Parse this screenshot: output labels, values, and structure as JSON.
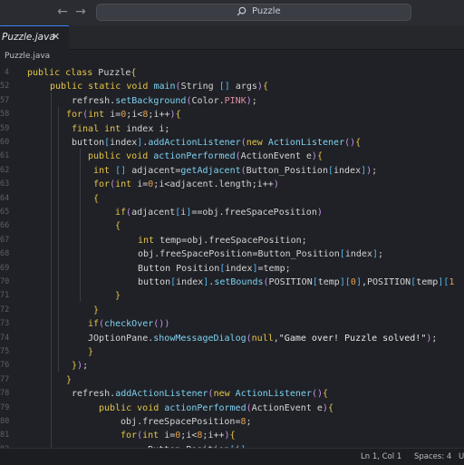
{
  "search": {
    "label": "Puzzle"
  },
  "tab": {
    "label": "Puzzle.java",
    "close_glyph": "✕"
  },
  "breadcrumb": "Puzzle.java",
  "gutter": [
    "4",
    "5",
    "",
    "",
    "",
    "",
    "",
    "",
    "",
    "",
    "",
    "",
    "",
    "",
    "",
    "",
    "",
    "",
    "",
    "",
    "",
    "",
    "",
    "",
    "",
    "",
    "",
    "",
    ""
  ],
  "lines": [
    {
      "n": "4",
      "t": "public class Puzzle{"
    },
    {
      "n": "52",
      "t": "public static void main(String [] args){"
    },
    {
      "n": "57",
      "t": "refresh.setBackground(Color.PINK);"
    },
    {
      "n": "58",
      "t": "for(int i=0;i<8;i++){"
    },
    {
      "n": "59",
      "t": "final int index i;"
    },
    {
      "n": "60",
      "t": "button[index].addActionListener(new ActionListener(){"
    },
    {
      "n": "61",
      "t": "public void actionPerformed(ActionEvent e){"
    },
    {
      "n": "62",
      "t": "int [] adjacent=getAdjacent(Button_Position[index]);"
    },
    {
      "n": "63",
      "t": "for(int i=0;i<adjacent.length;i++)"
    },
    {
      "n": "64",
      "t": "{"
    },
    {
      "n": "65",
      "t": "if(adjacent[i]==obj.freeSpacePosition)"
    },
    {
      "n": "66",
      "t": "{"
    },
    {
      "n": "67",
      "t": "int temp=obj.freeSpacePosition;"
    },
    {
      "n": "68",
      "t": "obj.freeSpacePosition=Button_Position[index];"
    },
    {
      "n": "69",
      "t": "Button Position[index]=temp;"
    },
    {
      "n": "70",
      "t": "button[index].setBounds(POSITION[temp][0],POSITION[temp][1"
    },
    {
      "n": "71",
      "t": "}"
    },
    {
      "n": "72",
      "t": "}"
    },
    {
      "n": "73",
      "t": "if(checkOver())"
    },
    {
      "n": "74",
      "t": "JOptionPane.showMessageDialog(null,\"Game over! Puzzle solved!\");"
    },
    {
      "n": "75",
      "t": "}"
    },
    {
      "n": "76",
      "t": "});"
    },
    {
      "n": "77",
      "t": "}"
    },
    {
      "n": "78",
      "t": "refresh.addActionListener(new ActionListener(){"
    },
    {
      "n": "79",
      "t": "public void actionPerformed(ActionEvent e){"
    },
    {
      "n": "80",
      "t": "obj.freeSpacePosition=8;"
    },
    {
      "n": "81",
      "t": "for(int i=0;i<8;i++){"
    },
    {
      "n": "82",
      "t": "Button_Position[i]="
    }
  ],
  "status": {
    "position": "Ln 1, Col 1",
    "spaces": "Spaces: 4",
    "encoding": "U"
  },
  "colors": {
    "keyword": "#e8c547",
    "function": "#7fd1f0",
    "background": "#1f2126",
    "accent": "#3b82f6"
  },
  "icons": [
    "back-arrow-icon",
    "forward-arrow-icon",
    "search-icon",
    "close-icon"
  ]
}
